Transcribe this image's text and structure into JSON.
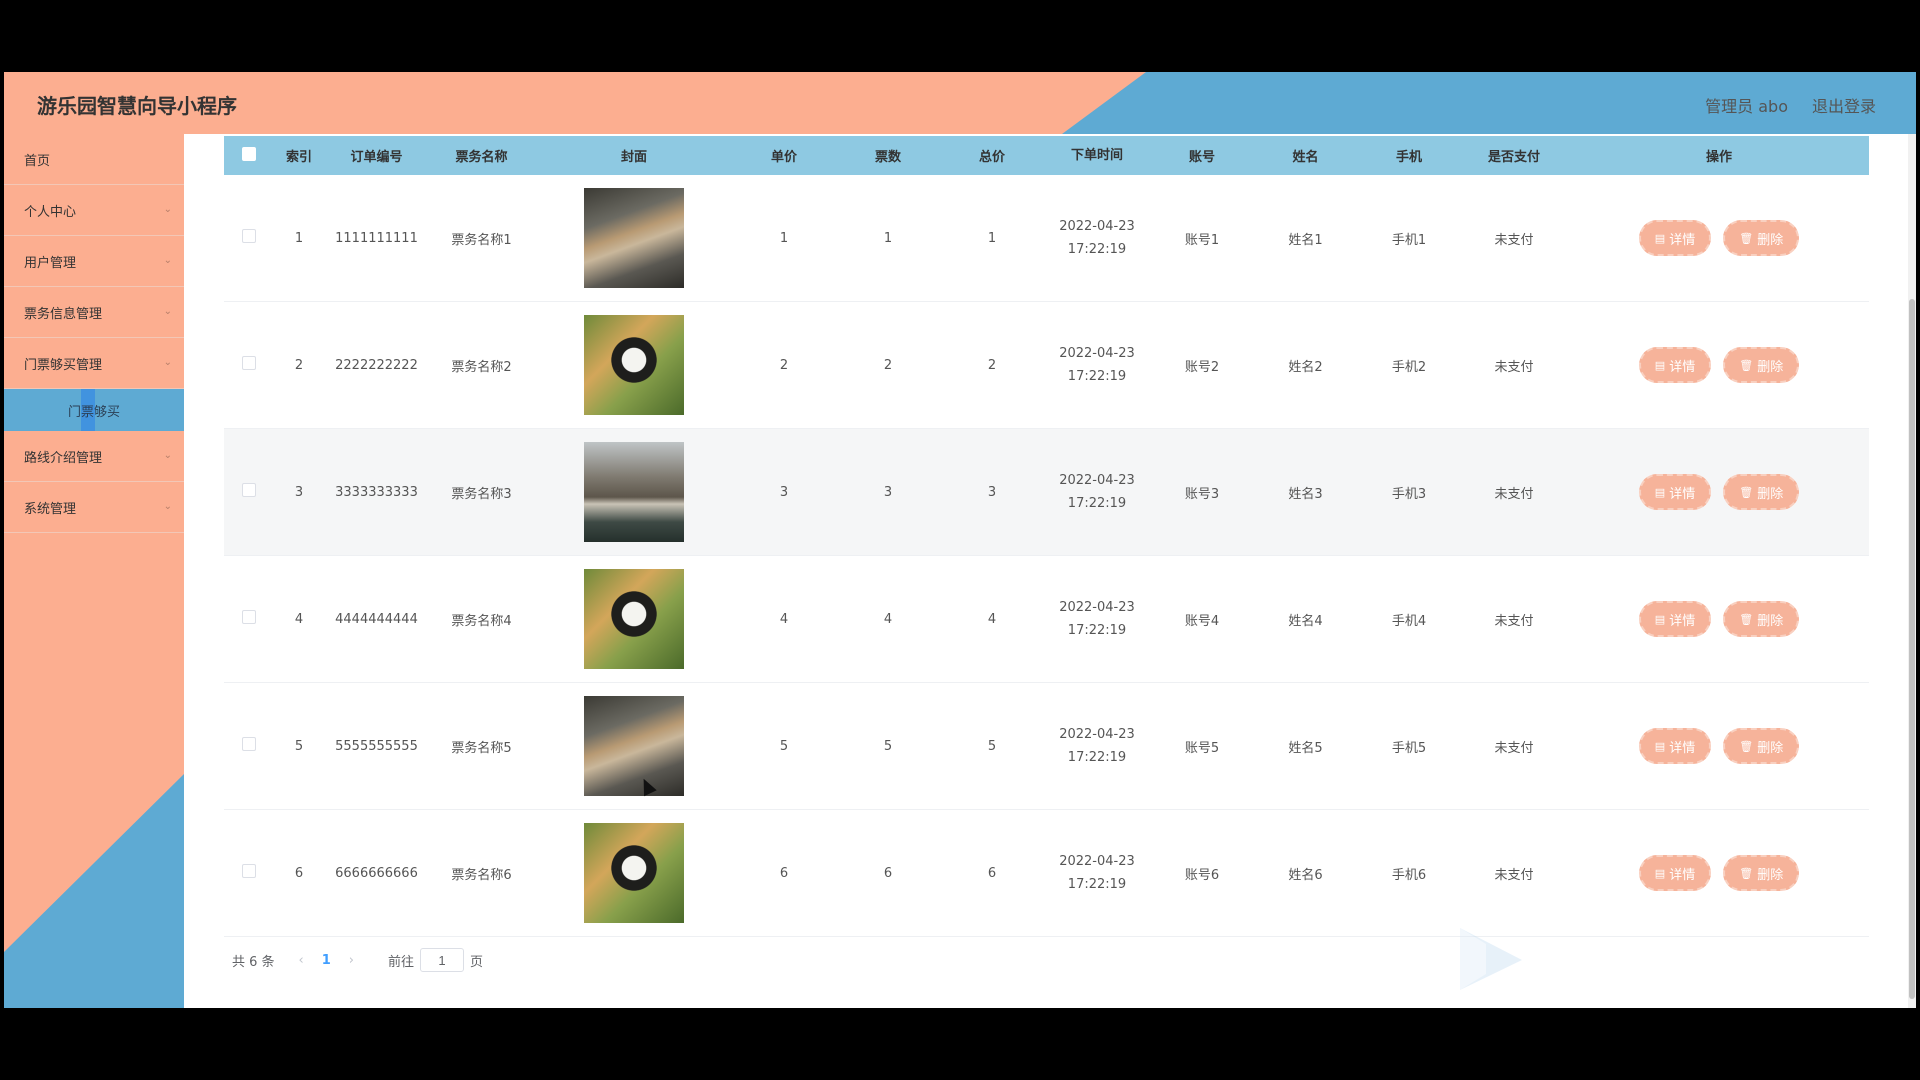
{
  "header": {
    "title": "游乐园智慧向导小程序",
    "admin": "管理员 abo",
    "logout": "退出登录"
  },
  "sidebar": {
    "items": [
      {
        "label": "首页",
        "chevron": false
      },
      {
        "label": "个人中心",
        "chevron": true
      },
      {
        "label": "用户管理",
        "chevron": true
      },
      {
        "label": "票务信息管理",
        "chevron": true
      },
      {
        "label": "门票够买管理",
        "chevron": true
      }
    ],
    "sub": {
      "label": "门票够买"
    },
    "items2": [
      {
        "label": "路线介绍管理",
        "chevron": true
      },
      {
        "label": "系统管理",
        "chevron": true
      }
    ]
  },
  "table": {
    "columns": [
      "索引",
      "订单编号",
      "票务名称",
      "封面",
      "单价",
      "票数",
      "总价",
      "下单时间",
      "账号",
      "姓名",
      "手机",
      "是否支付",
      "操作"
    ],
    "rows": [
      {
        "idx": "1",
        "order": "1111111111",
        "name": "票务名称1",
        "cover": "meerkat",
        "price": "1",
        "num": "1",
        "total": "1",
        "date": "2022-04-23",
        "time": "17:22:19",
        "account": "账号1",
        "uname": "姓名1",
        "phone": "手机1",
        "paid": "未支付"
      },
      {
        "idx": "2",
        "order": "2222222222",
        "name": "票务名称2",
        "cover": "panda",
        "price": "2",
        "num": "2",
        "total": "2",
        "date": "2022-04-23",
        "time": "17:22:19",
        "account": "账号2",
        "uname": "姓名2",
        "phone": "手机2",
        "paid": "未支付"
      },
      {
        "idx": "3",
        "order": "3333333333",
        "name": "票务名称3",
        "cover": "pond",
        "price": "3",
        "num": "3",
        "total": "3",
        "date": "2022-04-23",
        "time": "17:22:19",
        "account": "账号3",
        "uname": "姓名3",
        "phone": "手机3",
        "paid": "未支付"
      },
      {
        "idx": "4",
        "order": "4444444444",
        "name": "票务名称4",
        "cover": "panda",
        "price": "4",
        "num": "4",
        "total": "4",
        "date": "2022-04-23",
        "time": "17:22:19",
        "account": "账号4",
        "uname": "姓名4",
        "phone": "手机4",
        "paid": "未支付"
      },
      {
        "idx": "5",
        "order": "5555555555",
        "name": "票务名称5",
        "cover": "meerkat",
        "price": "5",
        "num": "5",
        "total": "5",
        "date": "2022-04-23",
        "time": "17:22:19",
        "account": "账号5",
        "uname": "姓名5",
        "phone": "手机5",
        "paid": "未支付"
      },
      {
        "idx": "6",
        "order": "6666666666",
        "name": "票务名称6",
        "cover": "panda",
        "price": "6",
        "num": "6",
        "total": "6",
        "date": "2022-04-23",
        "time": "17:22:19",
        "account": "账号6",
        "uname": "姓名6",
        "phone": "手机6",
        "paid": "未支付"
      }
    ],
    "detail_label": "详情",
    "delete_label": "删除"
  },
  "pager": {
    "total": "共 6 条",
    "current": "1",
    "goto_label": "前往",
    "goto_value": "1",
    "page_unit": "页"
  },
  "colors": {
    "header_bg": "#fcae90",
    "accent_blue": "#5eaad3",
    "table_head": "#8ec9e2",
    "button": "#f6b39a"
  },
  "icons": {
    "detail": "document-icon",
    "delete": "trash-icon"
  }
}
